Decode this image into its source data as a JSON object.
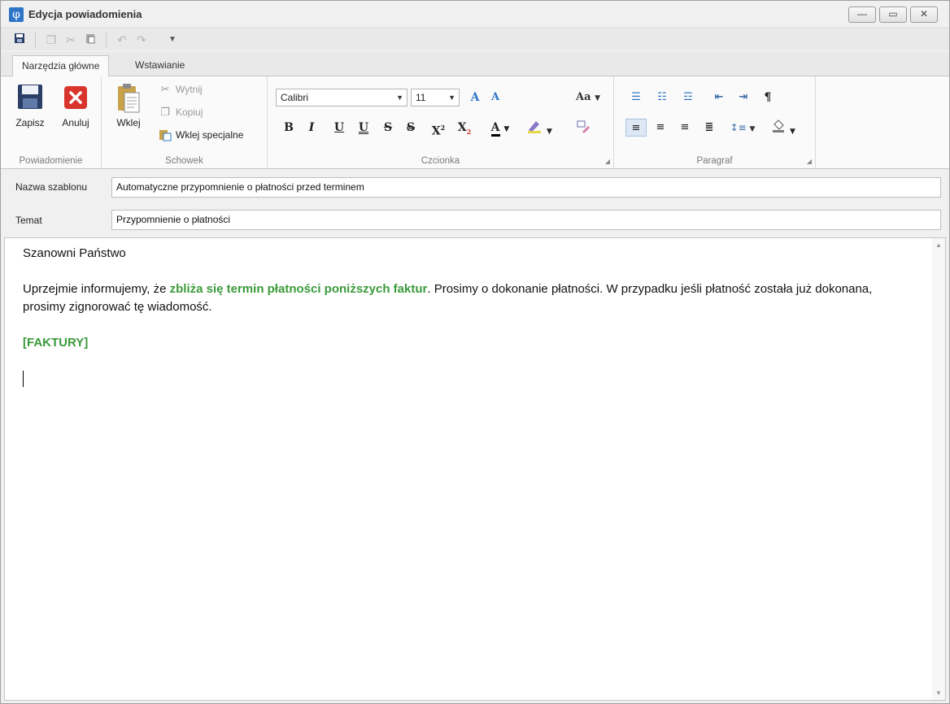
{
  "window": {
    "title": "Edycja powiadomienia",
    "icon_glyph": "φ",
    "buttons": {
      "minimize": "—",
      "maximize": "▭",
      "close": "✕"
    }
  },
  "tabs": [
    {
      "label": "Narzędzia główne",
      "active": true
    },
    {
      "label": "Wstawianie",
      "active": false
    }
  ],
  "ribbon": {
    "groups": {
      "notification": {
        "label": "Powiadomienie",
        "save": "Zapisz",
        "cancel": "Anuluj"
      },
      "clipboard": {
        "label": "Schowek",
        "paste": "Wklej",
        "cut": "Wytnij",
        "copy": "Kopiuj",
        "paste_special": "Wklej specjalne"
      },
      "font": {
        "label": "Czcionka",
        "font_name": "Calibri",
        "font_size": "11",
        "grow": "A",
        "shrink": "A",
        "change_case": "Aa",
        "bold": "B",
        "italic": "I",
        "underline": "U",
        "double_underline": "U",
        "strikethrough": "S",
        "double_strikethrough": "S",
        "superscript": "X",
        "subscript": "X",
        "font_color": "A"
      },
      "paragraph": {
        "label": "Paragraf",
        "pilcrow": "¶"
      }
    }
  },
  "form": {
    "template_name_label": "Nazwa szablonu",
    "template_name_value": "Automatyczne przypomnienie o płatności przed terminem",
    "subject_label": "Temat",
    "subject_value": "Przypomnienie o płatności"
  },
  "editor": {
    "greeting": "Szanowni Państwo",
    "para_before": "Uprzejmie informujemy, że ",
    "para_highlight": "zbliża się termin płatności poniższych faktur",
    "para_after": ". Prosimy o dokonanie płatności. W przypadku jeśli płatność została już dokonana, prosimy zignorować tę wiadomość.",
    "placeholder_tag": "[FAKTURY]"
  },
  "colors": {
    "highlight_green": "#3a9a3a",
    "cancel_red": "#d9342b",
    "save_navy": "#2b3f66",
    "accent_blue": "#2e75c8"
  }
}
